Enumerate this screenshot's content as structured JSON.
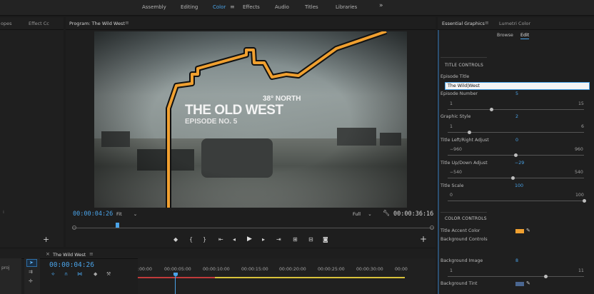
{
  "workspaces": {
    "items": [
      "Assembly",
      "Editing",
      "Color",
      "Effects",
      "Audio",
      "Titles",
      "Libraries"
    ],
    "active": "Color",
    "more": "»"
  },
  "left_panel": {
    "tab1": "opes",
    "tab2": "Effect Cc"
  },
  "program": {
    "tab": "Program: The Wild West",
    "timecode_current": "00:00:04:26",
    "timecode_end": "00:00:36:16",
    "zoom": "Fit",
    "quality": "Full"
  },
  "video_overlay": {
    "north": "38° NORTH",
    "title": "THE OLD WEST",
    "episode": "EPISODE NO. 5"
  },
  "essential_graphics": {
    "tab": "Essential Graphics",
    "tab2": "Lumetri Color",
    "browse": "Browse",
    "edit": "Edit",
    "title_controls": "TITLE CONTROLS",
    "episode_title_label": "Episode Title",
    "episode_title_value": "The Wild|West",
    "episode_number_label": "Episode Number",
    "episode_number_value": "5",
    "episode_number_min": "1",
    "episode_number_max": "15",
    "graphic_style_label": "Graphic Style",
    "graphic_style_value": "2",
    "graphic_style_min": "1",
    "graphic_style_max": "6",
    "lr_label": "Title Left/Right Adjust",
    "lr_value": "0",
    "lr_min": "−960",
    "lr_max": "960",
    "ud_label": "Title Up/Down Adjust",
    "ud_value": "−29",
    "ud_min": "−540",
    "ud_max": "540",
    "scale_label": "Title Scale",
    "scale_value": "100",
    "scale_min": "0",
    "scale_max": "100",
    "color_controls": "COLOR CONTROLS",
    "accent_label": "Title Accent Color",
    "bg_controls_label": "Background Controls",
    "bg_image_label": "Background Image",
    "bg_image_value": "8",
    "bg_image_min": "1",
    "bg_image_max": "11",
    "bg_tint_label": "Background Tint",
    "accent_color": "#f0a030",
    "tint_color": "#4a6690"
  },
  "timeline": {
    "tab": "The Wild West",
    "timecode": "00:00:04:26",
    "left_text": "proj",
    "ticks": [
      ":00:00",
      "00:00:05:00",
      "00:00:10:00",
      "00:00:15:00",
      "00:00:20:00",
      "00:00:25:00",
      "00:00:30:00",
      "00:00"
    ]
  },
  "slider_positions": {
    "episode_number": 0.32,
    "graphic_style": 0.16,
    "lr": 0.5,
    "ud": 0.48,
    "scale": 1.0,
    "bg_image": 0.72
  }
}
